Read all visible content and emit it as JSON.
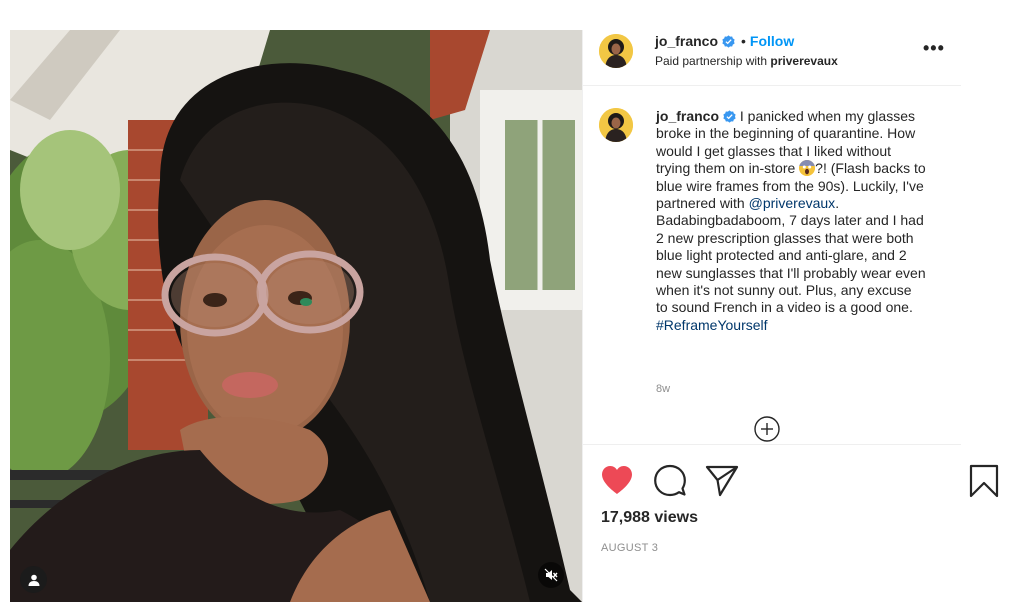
{
  "post": {
    "username": "jo_franco",
    "follow_label": "Follow",
    "dot": "•",
    "partnership_prefix": "Paid partnership with ",
    "partner": "priverevaux",
    "more_label": "•••"
  },
  "caption": {
    "username": "jo_franco",
    "text_1": " I panicked when my glasses broke in the beginning of quarantine. How would I get glasses that I liked without trying them on in-store ",
    "text_2": "?! (Flash backs to blue wire frames from the 90s). Luckily, I've partnered with ",
    "mention": "@priverevaux",
    "text_3": ". Badabingbadaboom, 7 days later and I had 2 new prescription glasses that were both blue light protected and anti-glare, and 2 new sunglasses that I'll probably wear even when it's not sunny out. Plus, any excuse to sound French in a video is a good one. ",
    "hashtag": "#ReframeYourself",
    "time_ago": "8w"
  },
  "stats": {
    "views": "17,988 views",
    "date": "AUGUST 3"
  },
  "icons": {
    "like": "heart-filled-icon",
    "comment": "comment-bubble-icon",
    "share": "paper-plane-icon",
    "save": "bookmark-icon",
    "load_more": "plus-circle-icon",
    "user_tag": "person-icon",
    "mute": "speaker-muted-icon",
    "verified": "verified-badge-icon"
  },
  "colors": {
    "like": "#ed4956",
    "link": "#00376b",
    "follow": "#0095f6",
    "verified": "#3897f0",
    "secondary_text": "#8e8e8e"
  }
}
